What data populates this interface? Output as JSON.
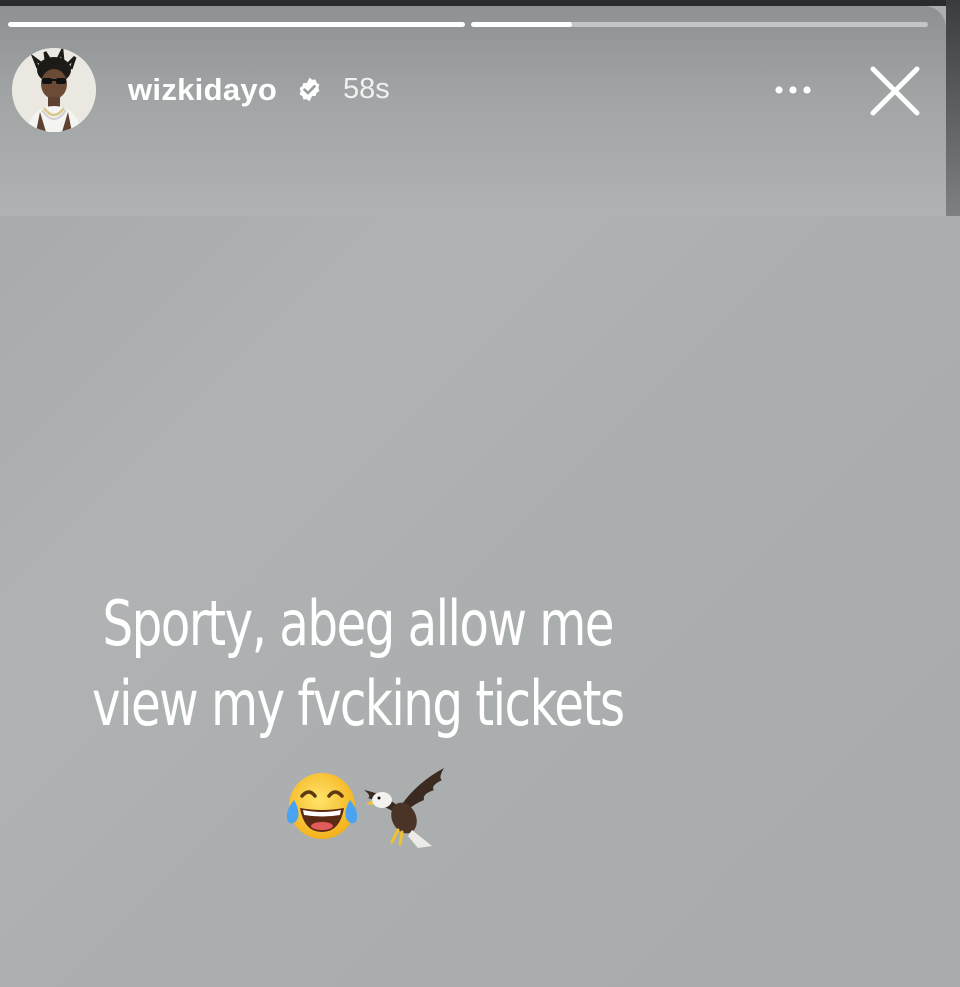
{
  "story": {
    "progress": [
      1.0,
      0.22
    ],
    "user": {
      "username": "wizkidayo",
      "verified": true,
      "time_ago": "58s",
      "avatar_icon": "avatar"
    },
    "actions": {
      "more_icon": "more-horizontal-icon",
      "close_icon": "close-icon"
    },
    "caption": {
      "line1": "Sporty, abeg allow me",
      "line2": "view my fvcking tickets"
    },
    "emojis": [
      "face-with-tears-of-joy-icon",
      "eagle-icon"
    ],
    "colors": {
      "background": "#a9abac",
      "text": "#ffffff",
      "verified_badge": "#ffffff"
    }
  }
}
